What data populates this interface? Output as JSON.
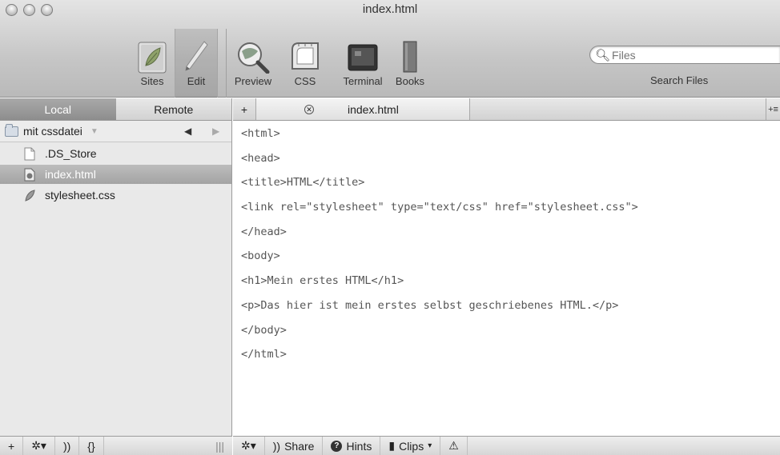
{
  "window": {
    "title": "index.html"
  },
  "toolbar": {
    "sites_label": "Sites",
    "edit_label": "Edit",
    "preview_label": "Preview",
    "css_label": "CSS",
    "terminal_label": "Terminal",
    "books_label": "Books",
    "search_placeholder": "Files",
    "search_caption": "Search Files"
  },
  "sidebar": {
    "tabs": {
      "local": "Local",
      "remote": "Remote"
    },
    "folder": "mit cssdatei",
    "files": [
      {
        "name": ".DS_Store"
      },
      {
        "name": "index.html"
      },
      {
        "name": "stylesheet.css"
      }
    ],
    "bottom": {
      "add": "+",
      "gear": "✲▾",
      "broadcast": "))",
      "braces": "{}",
      "resize": "|||"
    }
  },
  "editor": {
    "add_tab": "+",
    "close_tab": "✕",
    "tab_name": "index.html",
    "overflow": "+≡",
    "lines": [
      "<html>",
      "<head>",
      "<title>HTML</title>",
      "<link rel=\"stylesheet\" type=\"text/css\" href=\"stylesheet.css\">",
      "</head>",
      "<body>",
      "<h1>Mein erstes HTML</h1>",
      "<p>Das hier ist mein erstes selbst geschriebenes HTML.</p>",
      "</body>",
      "</html>"
    ],
    "bottom": {
      "gear": "✲▾",
      "share": "Share",
      "hints": "Hints",
      "clips": "Clips",
      "warning": "⚠"
    }
  }
}
